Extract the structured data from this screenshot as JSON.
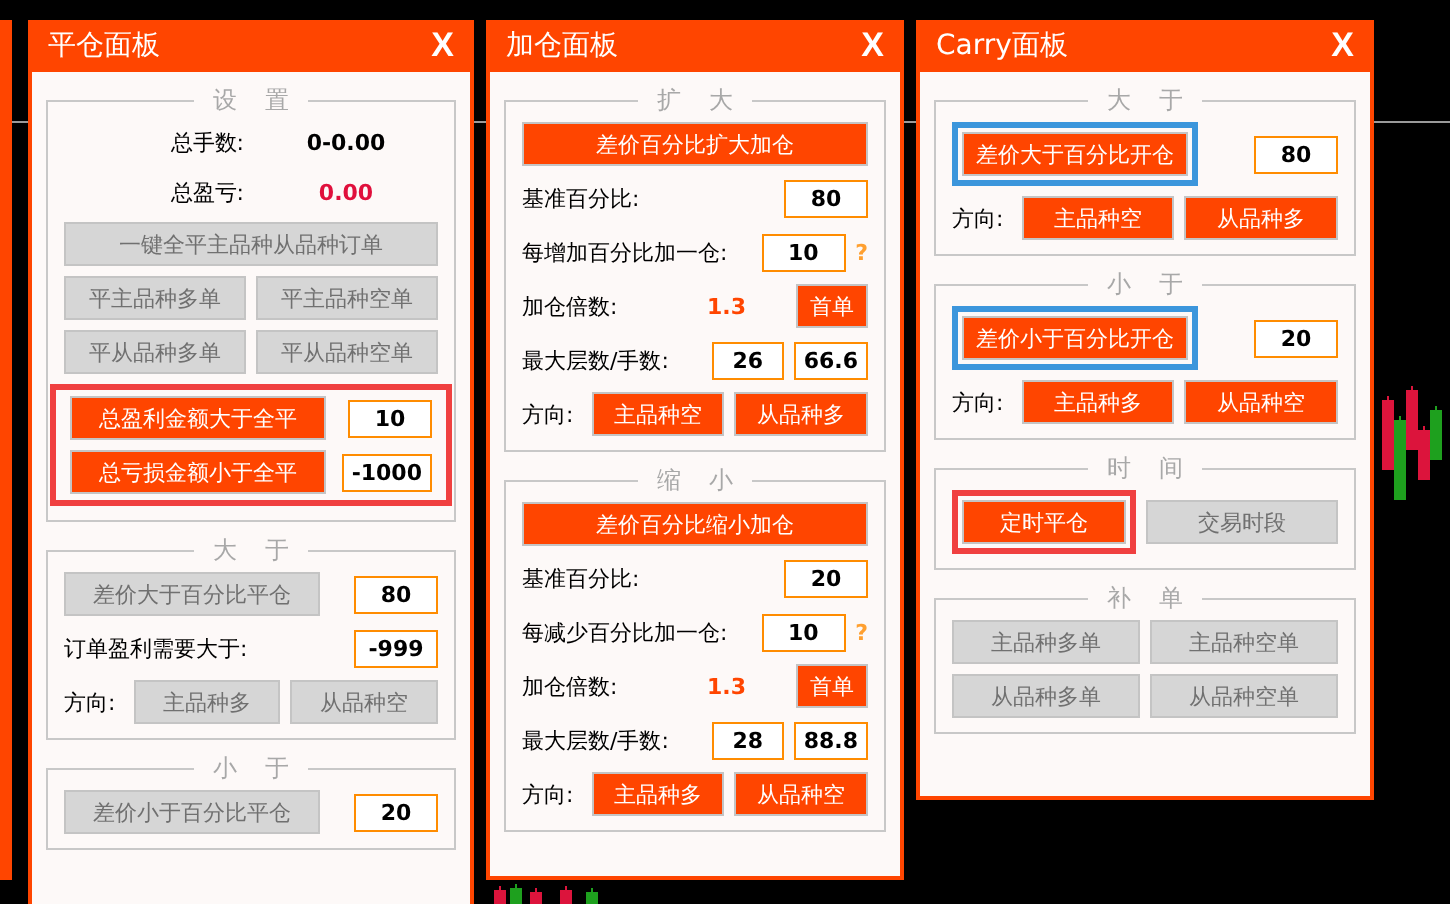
{
  "panels": [
    {
      "title": "平仓面板",
      "close": "X",
      "sections": [
        {
          "legend": "设 置",
          "rows": [
            {
              "kind": "stat",
              "label": "总手数:",
              "value": "0-0.00",
              "color": "#000000"
            },
            {
              "kind": "stat",
              "label": "总盈亏:",
              "value": "0.00",
              "color": "#e0103c"
            },
            {
              "kind": "wide",
              "buttons": [
                {
                  "label": "一键全平主品种从品种订单",
                  "on": false
                }
              ]
            },
            {
              "kind": "pair",
              "buttons": [
                {
                  "label": "平主品种多单",
                  "on": false
                },
                {
                  "label": "平主品种空单",
                  "on": false
                }
              ]
            },
            {
              "kind": "pair",
              "buttons": [
                {
                  "label": "平从品种多单",
                  "on": false
                },
                {
                  "label": "平从品种空单",
                  "on": false
                }
              ]
            },
            {
              "kind": "group",
              "color": "#f04040",
              "rows": [
                {
                  "kind": "button_input",
                  "buttons": [
                    {
                      "label": "总盈利金额大于全平",
                      "on": true
                    }
                  ],
                  "value": "10"
                },
                {
                  "kind": "button_input",
                  "buttons": [
                    {
                      "label": "总亏损金额小于全平",
                      "on": true
                    }
                  ],
                  "value": "-1000"
                }
              ]
            }
          ]
        },
        {
          "legend": "大 于",
          "rows": [
            {
              "kind": "button_input",
              "buttons": [
                {
                  "label": "差价大于百分比平仓",
                  "on": false
                }
              ],
              "value": "80"
            },
            {
              "kind": "label_input",
              "label": "订单盈利需要大于:",
              "value": "-999"
            },
            {
              "kind": "direction",
              "label": "方向:",
              "buttons": [
                {
                  "label": "主品种多",
                  "on": false
                },
                {
                  "label": "从品种空",
                  "on": false
                }
              ]
            }
          ]
        },
        {
          "legend": "小 于",
          "rows": [
            {
              "kind": "button_input",
              "buttons": [
                {
                  "label": "差价小于百分比平仓",
                  "on": false
                }
              ],
              "value": "20"
            }
          ]
        }
      ]
    },
    {
      "title": "加仓面板",
      "close": "X",
      "sections": [
        {
          "legend": "扩 大",
          "rows": [
            {
              "kind": "wide",
              "buttons": [
                {
                  "label": "差价百分比扩大加仓",
                  "on": true
                }
              ]
            },
            {
              "kind": "label_input",
              "label": "基准百分比:",
              "value": "80"
            },
            {
              "kind": "label_input",
              "label": "每增加百分比加一仓:",
              "value": "10",
              "help": "?"
            },
            {
              "kind": "label_value_button",
              "label": "加仓倍数:",
              "value": "1.3",
              "buttons": [
                {
                  "label": "首单",
                  "on": true
                }
              ]
            },
            {
              "kind": "label_inputs",
              "label": "最大层数/手数:",
              "values": [
                "26",
                "66.6"
              ]
            },
            {
              "kind": "direction",
              "label": "方向:",
              "buttons": [
                {
                  "label": "主品种空",
                  "on": true
                },
                {
                  "label": "从品种多",
                  "on": true
                }
              ]
            }
          ]
        },
        {
          "legend": "缩 小",
          "rows": [
            {
              "kind": "wide",
              "buttons": [
                {
                  "label": "差价百分比缩小加仓",
                  "on": true
                }
              ]
            },
            {
              "kind": "label_input",
              "label": "基准百分比:",
              "value": "20"
            },
            {
              "kind": "label_input",
              "label": "每减少百分比加一仓:",
              "value": "10",
              "help": "?"
            },
            {
              "kind": "label_value_button",
              "label": "加仓倍数:",
              "value": "1.3",
              "buttons": [
                {
                  "label": "首单",
                  "on": true
                }
              ]
            },
            {
              "kind": "label_inputs",
              "label": "最大层数/手数:",
              "values": [
                "28",
                "88.8"
              ]
            },
            {
              "kind": "direction",
              "label": "方向:",
              "buttons": [
                {
                  "label": "主品种多",
                  "on": true
                },
                {
                  "label": "从品种空",
                  "on": true
                }
              ]
            }
          ]
        }
      ]
    },
    {
      "title": "Carry面板",
      "close": "X",
      "sections": [
        {
          "legend": "大 于",
          "rows": [
            {
              "kind": "button_input",
              "buttons": [
                {
                  "label": "差价大于百分比开仓",
                  "on": true,
                  "color": "#3c96dc"
                }
              ],
              "value": "80"
            },
            {
              "kind": "direction",
              "label": "方向:",
              "buttons": [
                {
                  "label": "主品种空",
                  "on": true
                },
                {
                  "label": "从品种多",
                  "on": true
                }
              ]
            }
          ]
        },
        {
          "legend": "小 于",
          "rows": [
            {
              "kind": "button_input",
              "buttons": [
                {
                  "label": "差价小于百分比开仓",
                  "on": true,
                  "color": "#3c96dc"
                }
              ],
              "value": "20"
            },
            {
              "kind": "direction",
              "label": "方向:",
              "buttons": [
                {
                  "label": "主品种多",
                  "on": true
                },
                {
                  "label": "从品种空",
                  "on": true
                }
              ]
            }
          ]
        },
        {
          "legend": "时 间",
          "rows": [
            {
              "kind": "pair",
              "buttons": [
                {
                  "label": "定时平仓",
                  "on": true,
                  "color": "#f04040"
                },
                {
                  "label": "交易时段",
                  "on": false
                }
              ]
            }
          ]
        },
        {
          "legend": "补 单",
          "rows": [
            {
              "kind": "pair",
              "buttons": [
                {
                  "label": "主品种多单",
                  "on": false
                },
                {
                  "label": "主品种空单",
                  "on": false
                }
              ]
            },
            {
              "kind": "pair",
              "buttons": [
                {
                  "label": "从品种多单",
                  "on": false
                },
                {
                  "label": "从品种空单",
                  "on": false
                }
              ]
            }
          ]
        }
      ]
    }
  ]
}
